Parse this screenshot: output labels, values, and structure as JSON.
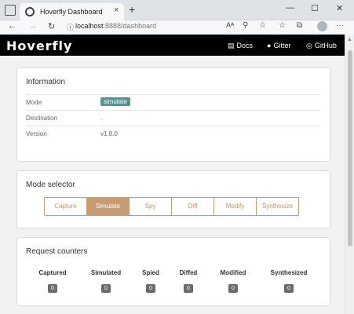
{
  "browser": {
    "tab_title": "Hoverfly Dashboard",
    "tab_close": "×",
    "new_tab": "+",
    "url_host": "localhost",
    "url_path": ":8888/dashboard",
    "win_min": "—",
    "win_max": "☐",
    "win_close": "✕",
    "nav_back": "←",
    "nav_forward": "→",
    "nav_reload": "↻",
    "nav_info": "ⓘ",
    "tool_read": "Aᴬ",
    "tool_zoom": "⚲",
    "tool_fav": "☆",
    "tool_favbar": "☆",
    "tool_collections": "⧉",
    "tool_menu": "···"
  },
  "app": {
    "logo": "Hoverfly",
    "nav": [
      {
        "icon": "▤",
        "label": "Docs"
      },
      {
        "icon": "●",
        "label": "Gitter"
      },
      {
        "icon": "◎",
        "label": "GitHub"
      }
    ]
  },
  "information": {
    "title": "Information",
    "rows": [
      {
        "label": "Mode",
        "value": "simulate"
      },
      {
        "label": "Destination",
        "value": "."
      },
      {
        "label": "Version",
        "value": "v1.8.0"
      }
    ]
  },
  "mode_selector": {
    "title": "Mode selector",
    "modes": [
      "Capture",
      "Simulate",
      "Spy",
      "Diff",
      "Modify",
      "Synthesize"
    ],
    "active": "Simulate"
  },
  "counters": {
    "title": "Request counters",
    "items": [
      {
        "label": "Captured",
        "value": "0"
      },
      {
        "label": "Simulated",
        "value": "0"
      },
      {
        "label": "Spied",
        "value": "0"
      },
      {
        "label": "Diffed",
        "value": "0"
      },
      {
        "label": "Modified",
        "value": "0"
      },
      {
        "label": "Synthesized",
        "value": "0"
      }
    ]
  }
}
